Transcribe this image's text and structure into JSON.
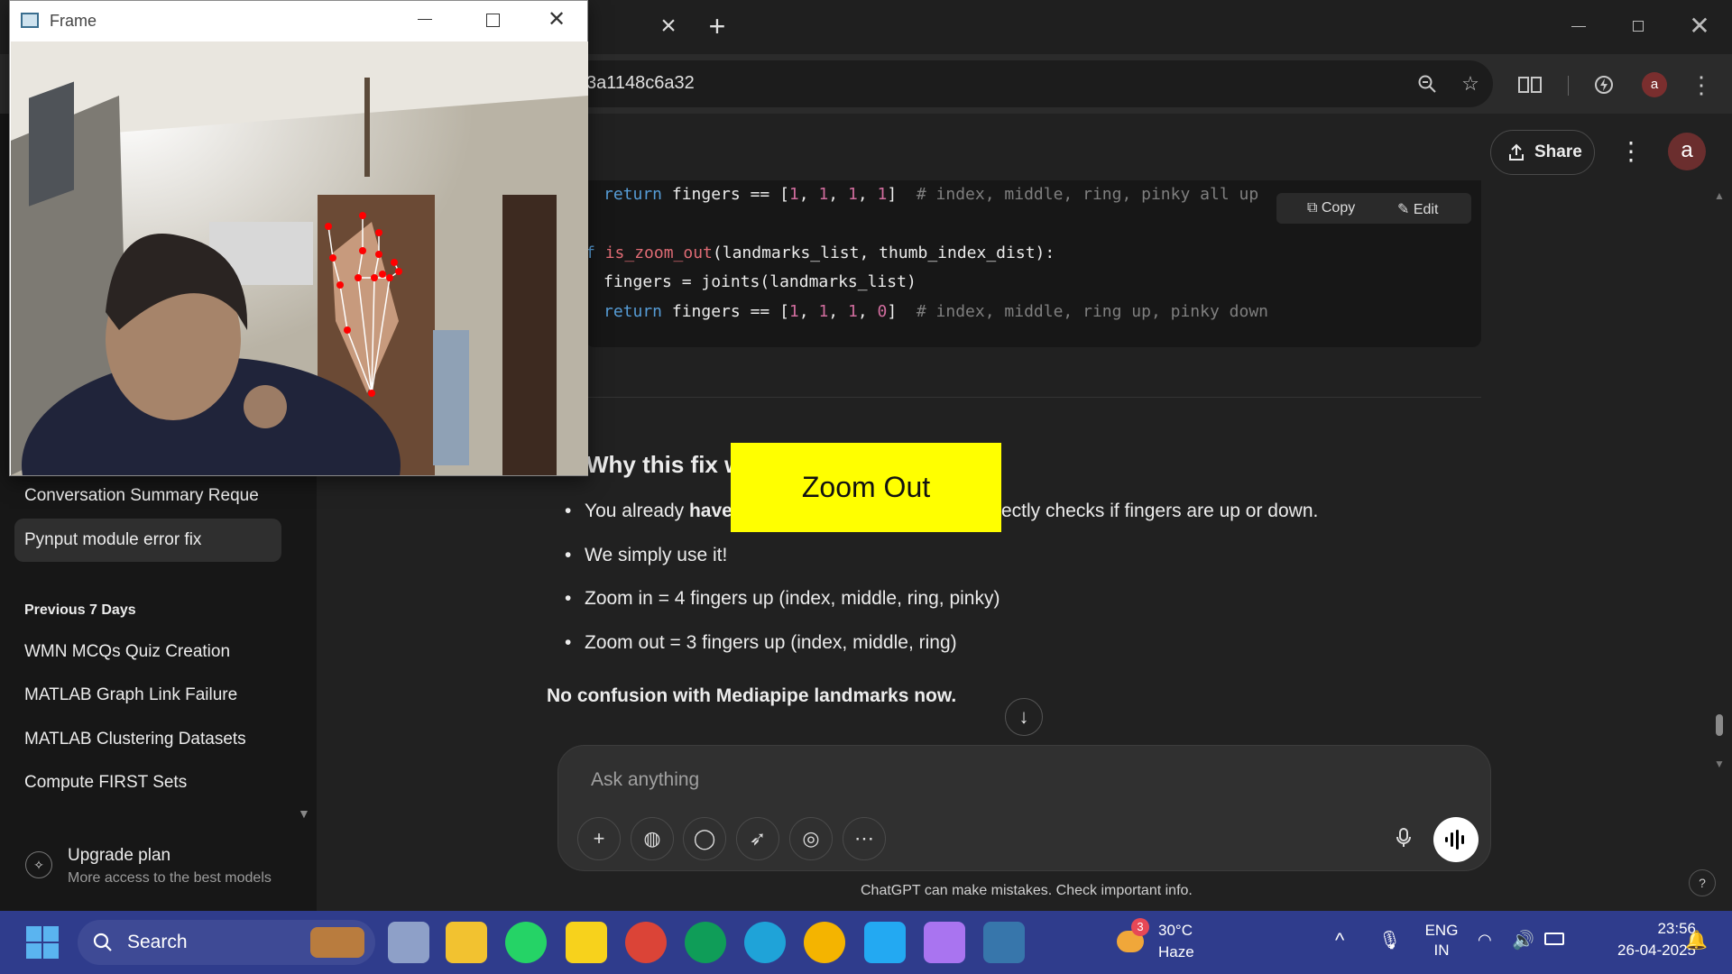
{
  "browser": {
    "url_fragment": "3a1148c6a32",
    "tab_close": "×",
    "new_tab": "+",
    "profile_letter": "a"
  },
  "header": {
    "share_label": "Share",
    "avatar_letter": "a"
  },
  "code": {
    "copy_label": "Copy",
    "edit_label": "Edit",
    "line1": {
      "kw": "return",
      "text": " fingers == [",
      "n1": "1",
      "c1": ", ",
      "n2": "1",
      "c2": ", ",
      "n3": "1",
      "c3": ", ",
      "n4": "1",
      "end": "]  ",
      "comment": "# index, middle, ring, pinky all up"
    },
    "line2": {
      "prefix": "f ",
      "fn": "is_zoom_out",
      "rest": "(landmarks_list, thumb_index_dist):"
    },
    "line3": {
      "text": "fingers = joints(landmarks_list)"
    },
    "line4": {
      "kw": "return",
      "text": " fingers == [",
      "n1": "1",
      "c1": ", ",
      "n2": "1",
      "c2": ", ",
      "n3": "1",
      "c3": ", ",
      "n4": "0",
      "end": "]  ",
      "comment": "# index, middle, ring up, pinky down"
    }
  },
  "answer": {
    "heading": "Why this fix w",
    "bullet1_pre": "You already ",
    "bullet1_bold": "have",
    "bullet1_post": "ectly checks if fingers are up or down.",
    "bullet2": "We simply use it!",
    "bullet3": "Zoom in = 4 fingers up (index, middle, ring, pinky)",
    "bullet4": "Zoom out = 3 fingers up (index, middle, ring)",
    "conclusion": "No confusion with Mediapipe landmarks now."
  },
  "composer": {
    "placeholder": "Ask anything",
    "disclaimer": "ChatGPT can make mistakes. Check important info.",
    "help": "?"
  },
  "sidebar": {
    "items_recent": [
      {
        "label": "Conversation Summary Reque",
        "unread": true
      },
      {
        "label": "Pynput module error fix",
        "active": true
      }
    ],
    "section_label": "Previous 7 Days",
    "items_week": [
      {
        "label": "WMN MCQs Quiz Creation"
      },
      {
        "label": "MATLAB Graph Link Failure"
      },
      {
        "label": "MATLAB Clustering Datasets"
      },
      {
        "label": "Compute FIRST Sets"
      }
    ],
    "upgrade_title": "Upgrade plan",
    "upgrade_subtitle": "More access to the best models"
  },
  "frame_window": {
    "title": "Frame",
    "overlay_label": "Zoom Out"
  },
  "taskbar": {
    "search_label": "Search",
    "weather_temp": "30°C",
    "weather_desc": "Haze",
    "weather_badge": "3",
    "lang_line1": "ENG",
    "lang_line2": "IN",
    "time": "23:56",
    "date": "26-04-2025"
  },
  "colors": {
    "accent_dot": "#3b82f6",
    "overlay_bg": "#ffff00",
    "taskbar_bg": "#2f3c8c"
  }
}
